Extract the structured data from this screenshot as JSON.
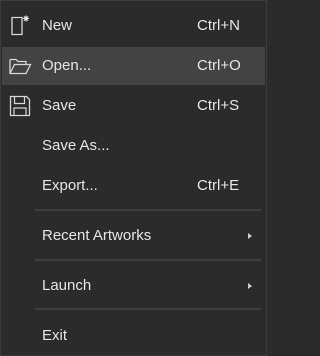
{
  "menu": {
    "items": [
      {
        "label": "New",
        "shortcut": "Ctrl+N",
        "icon": "new-file-icon"
      },
      {
        "label": "Open...",
        "shortcut": "Ctrl+O",
        "icon": "open-folder-icon",
        "highlighted": true
      },
      {
        "label": "Save",
        "shortcut": "Ctrl+S",
        "icon": "save-disk-icon"
      },
      {
        "label": "Save As..."
      },
      {
        "label": "Export...",
        "shortcut": "Ctrl+E"
      },
      {
        "label": "Recent Artworks",
        "submenu": true
      },
      {
        "label": "Launch",
        "submenu": true
      },
      {
        "label": "Exit"
      }
    ]
  },
  "colors": {
    "background": "#2b2b2b",
    "highlight": "#434343",
    "text": "#e6e6e6",
    "separator": "#3e3e3e"
  }
}
